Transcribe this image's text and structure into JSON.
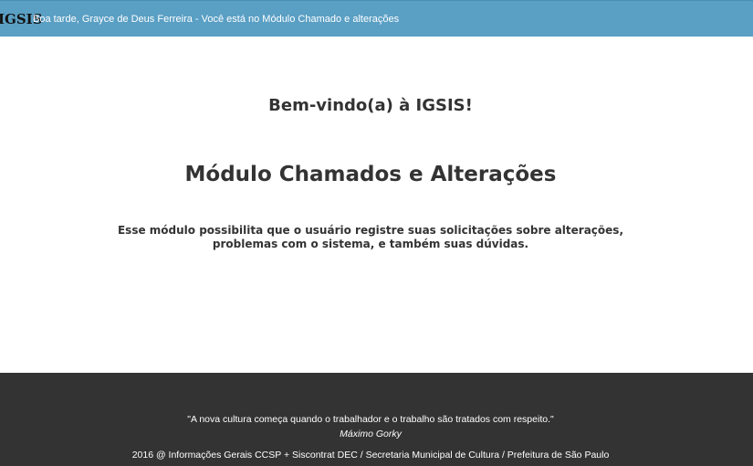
{
  "header": {
    "logo_text": "IGSIS",
    "greeting": "Boa tarde, Grayce de Deus Ferreira - Você está no Módulo Chamado e alterações",
    "background_color": "#5a9fc4"
  },
  "main": {
    "welcome": "Bem-vindo(a) à IGSIS!",
    "module_title": "Módulo Chamados e Alterações",
    "description_line1": "Esse módulo possibilita que o usuário registre suas solicitações sobre alterações,",
    "description_line2": "problemas com o sistema, e também suas dúvidas."
  },
  "footer": {
    "quote": "\"A nova cultura começa quando o trabalhador e o trabalho são tratados com respeito.\"",
    "author": "Máximo Gorky",
    "copyright": "2016 @ Informações Gerais CCSP + Siscontrat DEC / Secretaria Municipal de Cultura / Prefeitura de São Paulo",
    "background_color": "#333333"
  }
}
